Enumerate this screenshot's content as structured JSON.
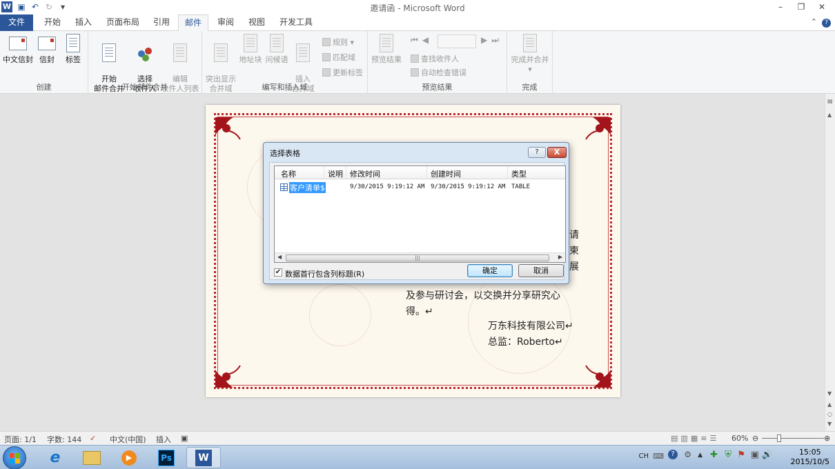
{
  "window": {
    "app_icon": "W",
    "title": "邀请函 - Microsoft Word",
    "controls": [
      "minimize-icon",
      "restore-icon",
      "close-icon"
    ]
  },
  "ribbon_tabs": [
    "文件",
    "开始",
    "插入",
    "页面布局",
    "引用",
    "邮件",
    "审阅",
    "视图",
    "开发工具"
  ],
  "active_tab": "邮件",
  "ribbon": {
    "groups": [
      {
        "label": "创建",
        "buttons": [
          "中文信封",
          "信封",
          "标签"
        ]
      },
      {
        "label": "开始邮件合并",
        "buttons": [
          "开始\n邮件合并",
          "选择\n收件人",
          "编辑\n收件人列表"
        ]
      },
      {
        "label": "编写和插入域",
        "buttons": [
          "突出显示\n合并域",
          "地址块",
          "问候语",
          "插入\n合并域"
        ],
        "small": [
          "规则",
          "匹配域",
          "更新标签"
        ]
      },
      {
        "label": "预览结果",
        "buttons": [
          "预览结果"
        ],
        "small": [
          "查找收件人",
          "自动检查错误"
        ]
      },
      {
        "label": "完成",
        "buttons": [
          "完成并合并"
        ]
      }
    ]
  },
  "document": {
    "lines": [
      "请",
      "柬",
      "展",
      "及参与研讨会，以交换并分享研究心",
      "得。↵",
      "万东科技有限公司↵",
      "总监：Roberto↵"
    ]
  },
  "dialog": {
    "title": "选择表格",
    "help": "?",
    "close": "X",
    "columns": [
      "名称",
      "说明",
      "修改时间",
      "创建时间",
      "类型"
    ],
    "rows": [
      {
        "name": "客户清单$",
        "desc": "",
        "modified": "9/30/2015 9:19:12 AM",
        "created": "9/30/2015 9:19:12 AM",
        "type": "TABLE"
      }
    ],
    "first_row_headers_label": "数据首行包含列标题(R)",
    "first_row_headers_checked": true,
    "ok": "确定",
    "cancel": "取消"
  },
  "statusbar": {
    "page": "页面: 1/1",
    "words": "字数: 144",
    "language": "中文(中国)",
    "mode": "插入",
    "zoom": "60%",
    "zoom_value": 60
  },
  "taskbar": {
    "apps": [
      "start-button",
      "internet-explorer",
      "file-explorer",
      "media-player",
      "photoshop",
      "word"
    ],
    "ps_label": "Ps",
    "word_label": "W",
    "ime": "CH",
    "time": "15:05",
    "date": "2015/10/5"
  }
}
